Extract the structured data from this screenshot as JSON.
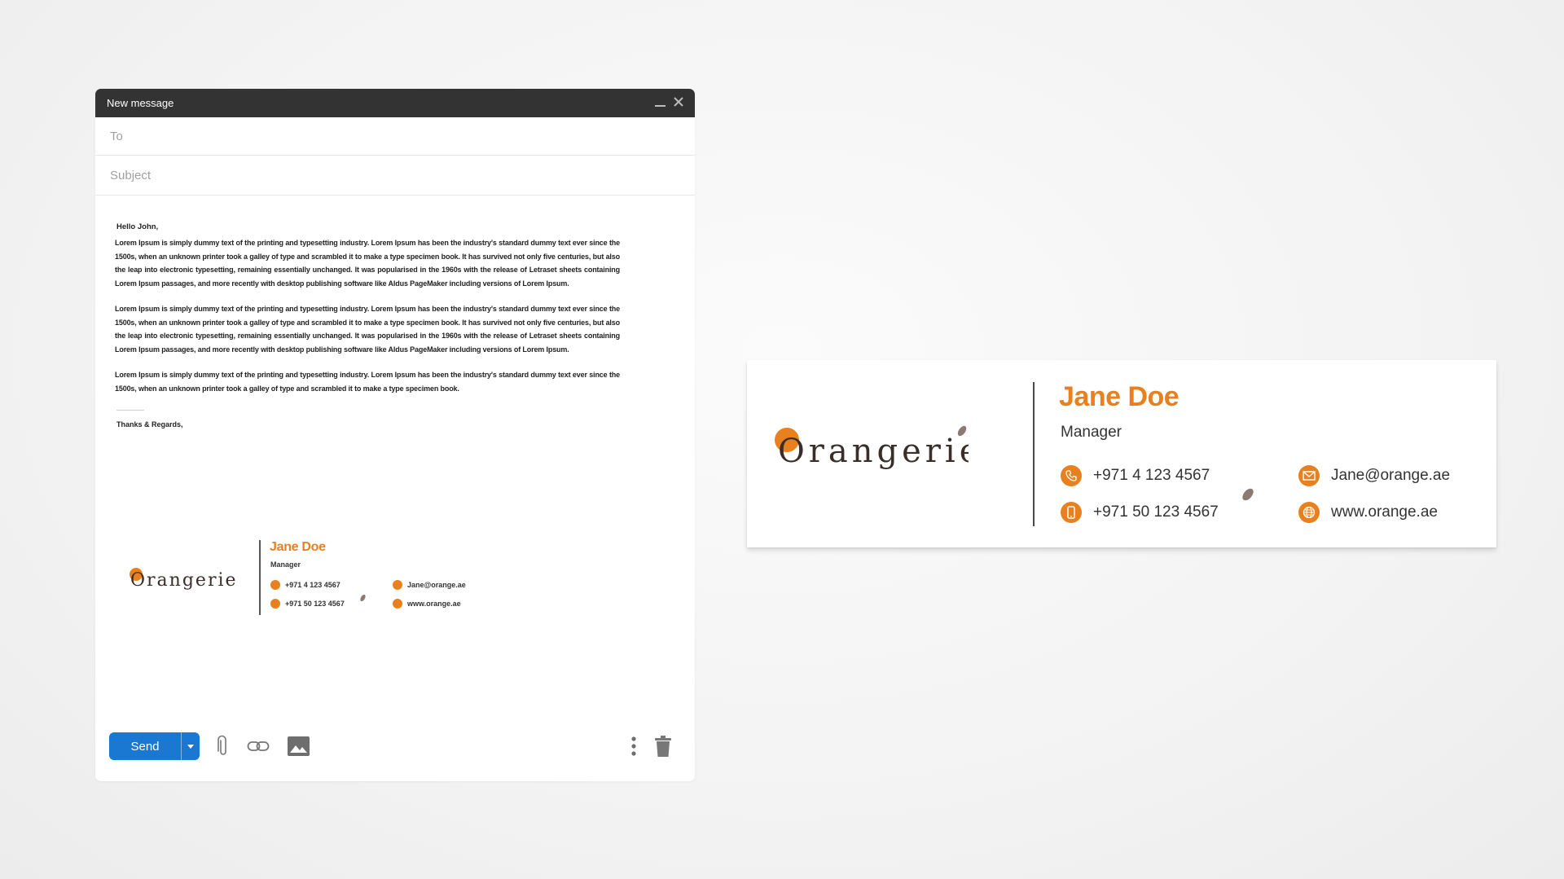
{
  "compose": {
    "title": "New message",
    "to_placeholder": "To",
    "subject_placeholder": "Subject",
    "greeting": "Hello John,",
    "paragraphs": [
      "Lorem Ipsum is simply dummy text of the printing and typesetting industry. Lorem Ipsum has been the industry's standard dummy text ever since the 1500s, when an unknown printer took a galley of type and scrambled it to make a type specimen book. It has survived not only five centuries, but also the leap into electronic typesetting, remaining essentially unchanged. It was popularised in the 1960s with the release of Letraset sheets containing Lorem Ipsum passages, and more recently with desktop publishing software like Aldus PageMaker including versions of Lorem Ipsum.",
      "Lorem Ipsum is simply dummy text of the printing and typesetting industry. Lorem Ipsum has been the industry's standard dummy text ever since the 1500s, when an unknown printer took a galley of type and scrambled it to make a type specimen book. It has survived not only five centuries, but also the leap into electronic typesetting, remaining essentially unchanged. It was popularised in the 1960s with the release of Letraset sheets containing Lorem Ipsum passages, and more recently with desktop publishing software like Aldus PageMaker including versions of Lorem Ipsum.",
      "Lorem Ipsum is simply dummy text of the printing and typesetting industry. Lorem Ipsum has been the industry's standard dummy text ever since the 1500s, when an unknown printer took a galley of type and scrambled it to make a type specimen book."
    ],
    "closing": "Thanks & Regards,",
    "send_label": "Send",
    "icons": [
      "minimize-icon",
      "close-icon",
      "attach-icon",
      "link-icon",
      "image-icon",
      "more-options-icon",
      "trash-icon",
      "send-dropdown-icon"
    ]
  },
  "signature": {
    "logo_text": "Orangerie",
    "name": "Jane Doe",
    "role": "Manager",
    "phone": "+971 4  123 4567",
    "mobile": "+971 50 123 4567",
    "email": "Jane@orange.ae",
    "website": "www.orange.ae",
    "phone_small": "+971 4 123 4567",
    "mobile_small": "+971 50 123 4567",
    "email_small": "Jane@orange.ae",
    "website_small": "www.orange.ae",
    "icons": [
      "phone-icon",
      "mobile-icon",
      "email-icon",
      "globe-icon",
      "leaf-icon"
    ]
  },
  "colors": {
    "accent": "#e8801d",
    "titlebar": "#333333",
    "send": "#1a78d2",
    "dark_text": "#3a2e2a"
  }
}
